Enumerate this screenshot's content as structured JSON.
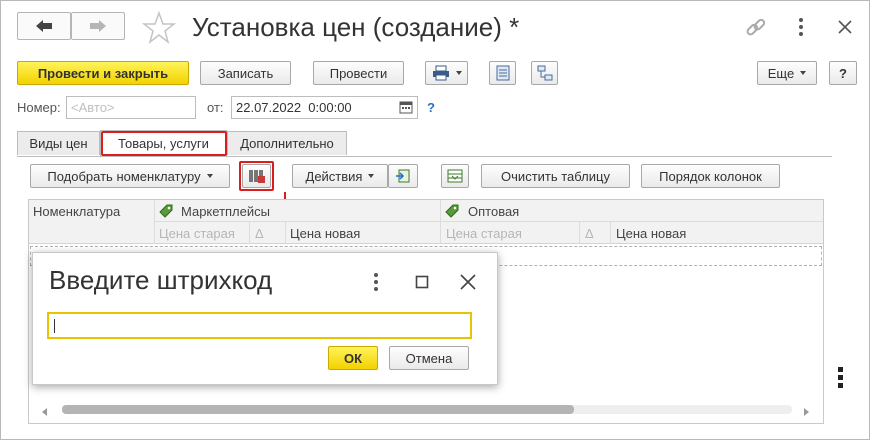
{
  "window": {
    "title": "Установка цен (создание) *"
  },
  "toolbar": {
    "post_close_label": "Провести и закрыть",
    "write_label": "Записать",
    "post_label": "Провести",
    "more_label": "Еще",
    "help_label": "?"
  },
  "header": {
    "number_label": "Номер:",
    "number_placeholder": "<Авто>",
    "from_label": "от:",
    "date_value": "22.07.2022  0:00:00",
    "date_help": "?"
  },
  "tabs": [
    {
      "label": "Виды цен",
      "active": false
    },
    {
      "label": "Товары, услуги",
      "active": true,
      "highlighted": true
    },
    {
      "label": "Дополнительно",
      "active": false
    }
  ],
  "table_toolbar": {
    "pick_label": "Подобрать номенклатуру",
    "actions_label": "Действия",
    "clear_label": "Очистить таблицу",
    "columns_label": "Порядок колонок"
  },
  "table": {
    "col_nomenclature": "Номенклатура",
    "group1": "Маркетплейсы",
    "group2": "Оптовая",
    "sub_old": "Цена старая",
    "sub_delta": "Δ",
    "sub_new": "Цена новая"
  },
  "dialog": {
    "title": "Введите штрихкод",
    "input_value": "",
    "ok_label": "ОК",
    "cancel_label": "Отмена"
  },
  "colors": {
    "accent_yellow": "#f5d800",
    "highlight_red": "#d81e1e",
    "input_focus": "#e8c400"
  }
}
